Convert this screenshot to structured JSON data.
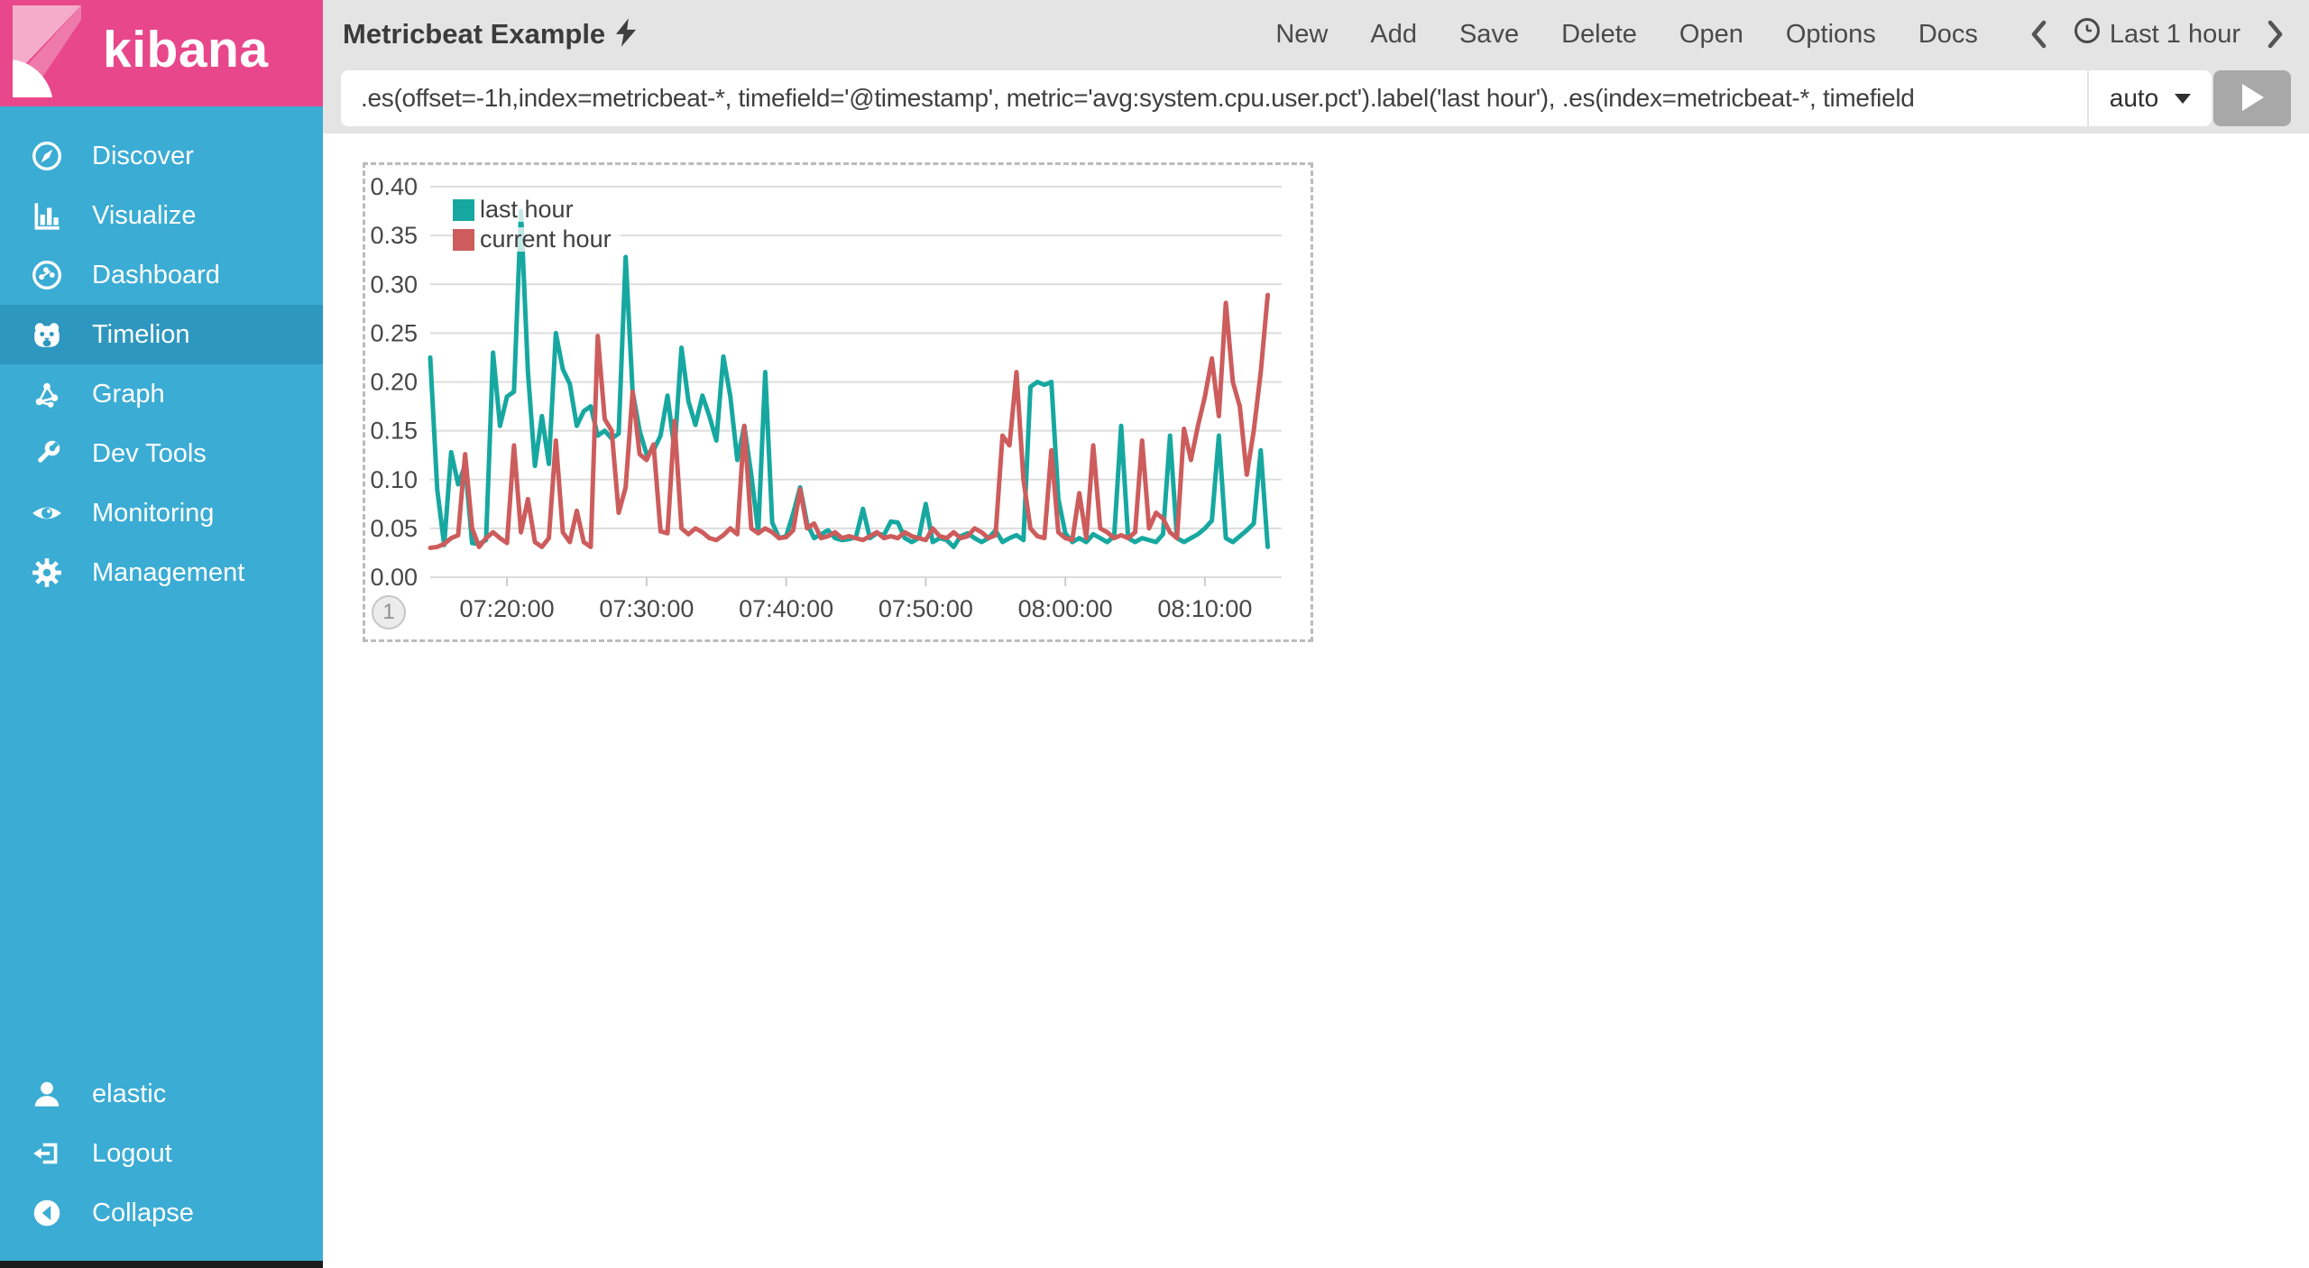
{
  "brand": {
    "name": "kibana"
  },
  "sidebar": {
    "items": [
      {
        "label": "Discover",
        "icon": "compass-icon"
      },
      {
        "label": "Visualize",
        "icon": "bar-chart-icon"
      },
      {
        "label": "Dashboard",
        "icon": "dashboard-icon"
      },
      {
        "label": "Timelion",
        "icon": "timelion-icon",
        "selected": true
      },
      {
        "label": "Graph",
        "icon": "graph-icon"
      },
      {
        "label": "Dev Tools",
        "icon": "wrench-icon"
      },
      {
        "label": "Monitoring",
        "icon": "eye-icon"
      },
      {
        "label": "Management",
        "icon": "gear-icon"
      }
    ],
    "footer_items": [
      {
        "label": "elastic",
        "icon": "user-icon"
      },
      {
        "label": "Logout",
        "icon": "logout-icon"
      },
      {
        "label": "Collapse",
        "icon": "collapse-icon"
      }
    ]
  },
  "header": {
    "title": "Metricbeat Example",
    "title_icon": "lightning-bolt-icon",
    "menu": [
      "New",
      "Add",
      "Save",
      "Delete",
      "Open",
      "Options",
      "Docs"
    ],
    "time_nav": {
      "range_label": "Last 1 hour"
    }
  },
  "query_bar": {
    "value": ".es(offset=-1h,index=metricbeat-*, timefield='@timestamp', metric='avg:system.cpu.user.pct').label('last hour'), .es(index=metricbeat-*, timefield",
    "interval": {
      "value": "auto"
    }
  },
  "panel": {
    "badge": "1"
  },
  "colors": {
    "sidebar": "#3BACD4",
    "sidebar_selected": "#2E97BF",
    "logo_bg": "#E8478B",
    "header_bg": "#E4E4E4",
    "play_button": "#A8A8A8",
    "grid": "#DDDDDD",
    "dashed_border": "#BBBBBB",
    "series_teal": "#16A8A0",
    "series_red": "#CD5C5C"
  },
  "chart_data": {
    "type": "line",
    "title": "",
    "x_start": "07:14:30",
    "x_step_seconds": 30,
    "x_window_minutes": 61,
    "ylim": [
      0,
      0.4
    ],
    "y_tick_step": 0.05,
    "y_tick_labels": [
      "0.00",
      "0.05",
      "0.10",
      "0.15",
      "0.20",
      "0.25",
      "0.30",
      "0.35",
      "0.40"
    ],
    "x_ticks": [
      {
        "t": 5.5,
        "label": "07:20:00"
      },
      {
        "t": 15.5,
        "label": "07:30:00"
      },
      {
        "t": 25.5,
        "label": "07:40:00"
      },
      {
        "t": 35.5,
        "label": "07:50:00"
      },
      {
        "t": 45.5,
        "label": "08:00:00"
      },
      {
        "t": 55.5,
        "label": "08:10:00"
      }
    ],
    "grid": true,
    "legend_position": "top-left",
    "series": [
      {
        "name": "last hour",
        "color": "#16A8A0",
        "values": [
          0.225,
          0.09,
          0.033,
          0.128,
          0.095,
          0.115,
          0.035,
          0.034,
          0.038,
          0.23,
          0.155,
          0.185,
          0.19,
          0.375,
          0.21,
          0.114,
          0.165,
          0.116,
          0.25,
          0.213,
          0.198,
          0.155,
          0.17,
          0.175,
          0.145,
          0.15,
          0.142,
          0.147,
          0.328,
          0.19,
          0.15,
          0.126,
          0.13,
          0.145,
          0.186,
          0.13,
          0.235,
          0.18,
          0.156,
          0.186,
          0.165,
          0.14,
          0.226,
          0.185,
          0.12,
          0.155,
          0.105,
          0.046,
          0.21,
          0.056,
          0.04,
          0.042,
          0.065,
          0.092,
          0.055,
          0.04,
          0.044,
          0.048,
          0.04,
          0.038,
          0.039,
          0.041,
          0.07,
          0.04,
          0.045,
          0.043,
          0.057,
          0.056,
          0.04,
          0.036,
          0.04,
          0.075,
          0.036,
          0.04,
          0.038,
          0.031,
          0.042,
          0.045,
          0.04,
          0.036,
          0.04,
          0.048,
          0.036,
          0.04,
          0.043,
          0.038,
          0.195,
          0.2,
          0.197,
          0.2,
          0.08,
          0.045,
          0.036,
          0.04,
          0.036,
          0.044,
          0.04,
          0.036,
          0.042,
          0.155,
          0.04,
          0.036,
          0.04,
          0.038,
          0.036,
          0.044,
          0.145,
          0.04,
          0.036,
          0.04,
          0.044,
          0.05,
          0.058,
          0.145,
          0.04,
          0.036,
          0.042,
          0.048,
          0.055,
          0.13,
          0.031
        ]
      },
      {
        "name": "current hour",
        "color": "#CD5C5C",
        "values": [
          0.03,
          0.031,
          0.034,
          0.04,
          0.043,
          0.126,
          0.05,
          0.031,
          0.04,
          0.046,
          0.04,
          0.035,
          0.135,
          0.046,
          0.08,
          0.036,
          0.031,
          0.04,
          0.14,
          0.046,
          0.036,
          0.068,
          0.036,
          0.031,
          0.247,
          0.162,
          0.15,
          0.066,
          0.092,
          0.19,
          0.126,
          0.12,
          0.136,
          0.047,
          0.045,
          0.16,
          0.05,
          0.044,
          0.05,
          0.046,
          0.04,
          0.038,
          0.043,
          0.05,
          0.044,
          0.155,
          0.05,
          0.045,
          0.05,
          0.046,
          0.04,
          0.041,
          0.048,
          0.09,
          0.05,
          0.055,
          0.04,
          0.042,
          0.046,
          0.04,
          0.042,
          0.04,
          0.038,
          0.042,
          0.046,
          0.04,
          0.042,
          0.04,
          0.046,
          0.042,
          0.04,
          0.038,
          0.05,
          0.042,
          0.04,
          0.046,
          0.04,
          0.042,
          0.05,
          0.046,
          0.04,
          0.043,
          0.145,
          0.135,
          0.21,
          0.1,
          0.05,
          0.042,
          0.04,
          0.13,
          0.046,
          0.04,
          0.038,
          0.086,
          0.04,
          0.135,
          0.05,
          0.046,
          0.04,
          0.043,
          0.04,
          0.046,
          0.14,
          0.05,
          0.066,
          0.06,
          0.046,
          0.04,
          0.152,
          0.12,
          0.155,
          0.185,
          0.224,
          0.165,
          0.281,
          0.2,
          0.175,
          0.105,
          0.15,
          0.21,
          0.289
        ]
      }
    ]
  }
}
